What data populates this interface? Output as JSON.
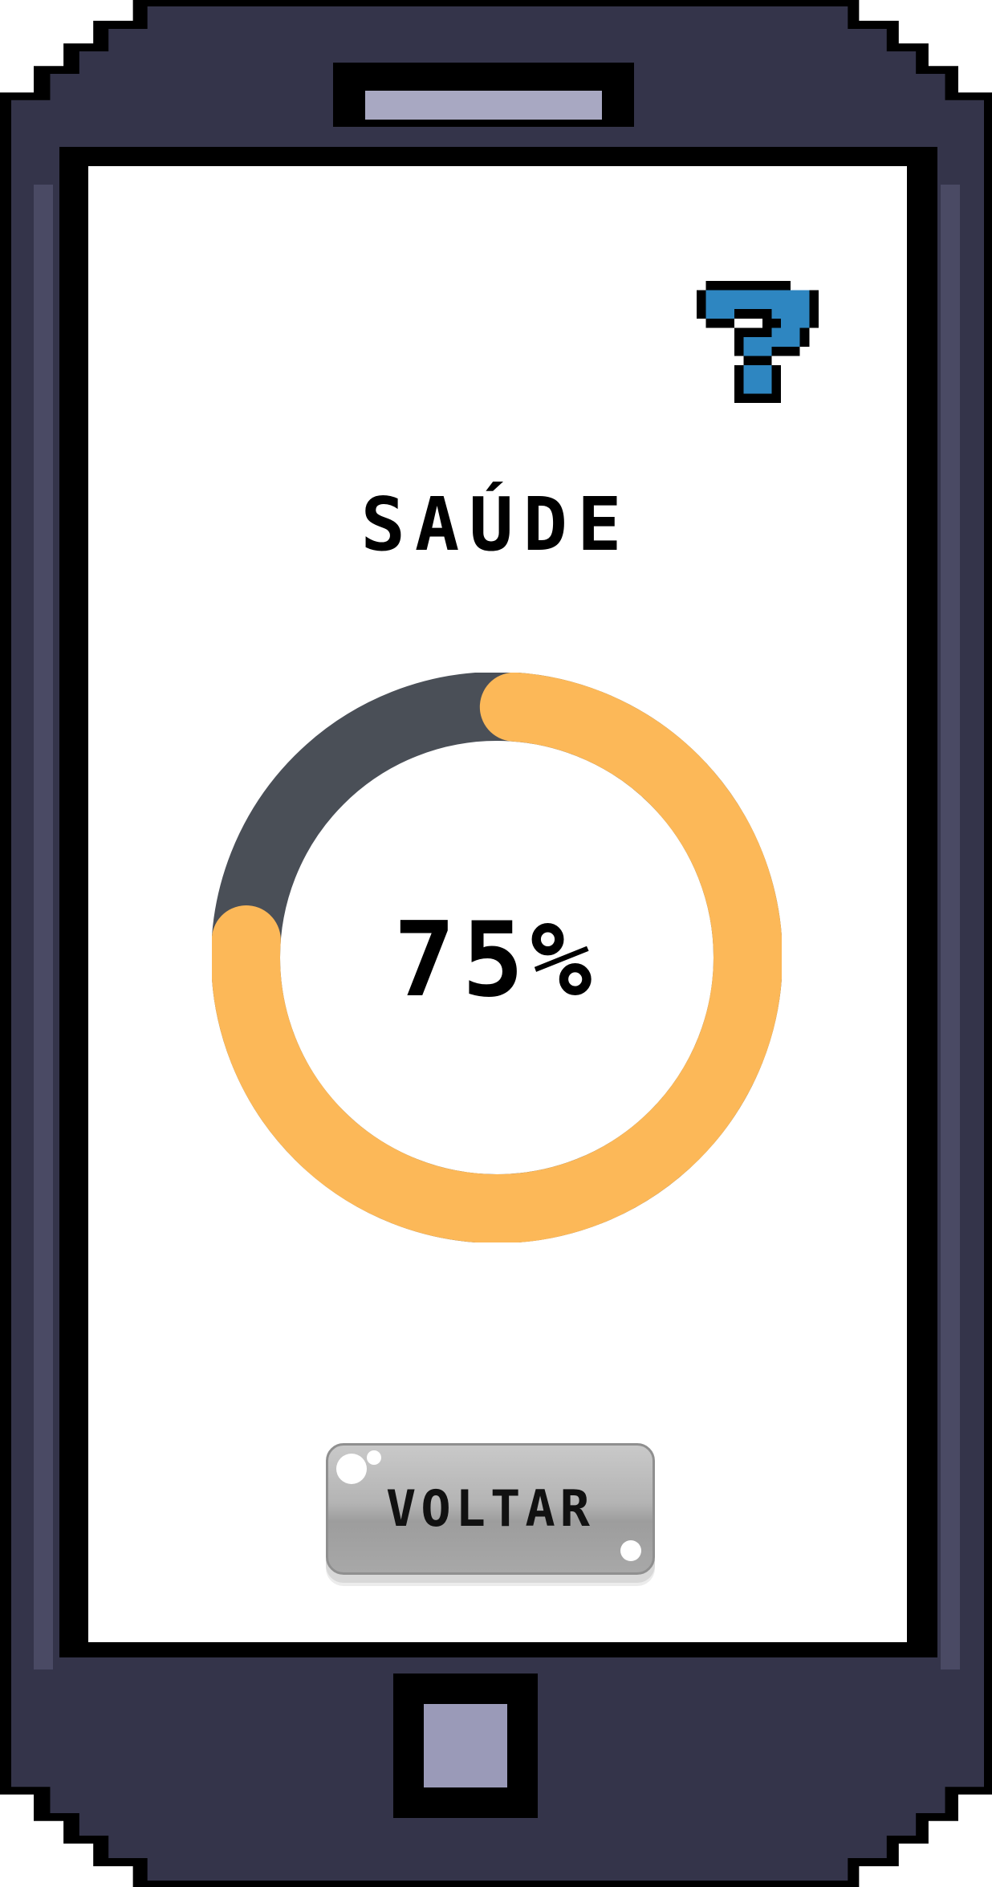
{
  "screen": {
    "title": "SAÚDE",
    "help_icon": "question-mark-icon",
    "gauge": {
      "value_label": "75%",
      "value": 0.75,
      "fill_color": "#fcb858",
      "track_color": "#4a4f57"
    },
    "back_button_label": "VOLTAR"
  },
  "colors": {
    "phone_body": "#34344a",
    "screen_background": "#ffffff",
    "help_icon_color": "#2e86c1"
  }
}
